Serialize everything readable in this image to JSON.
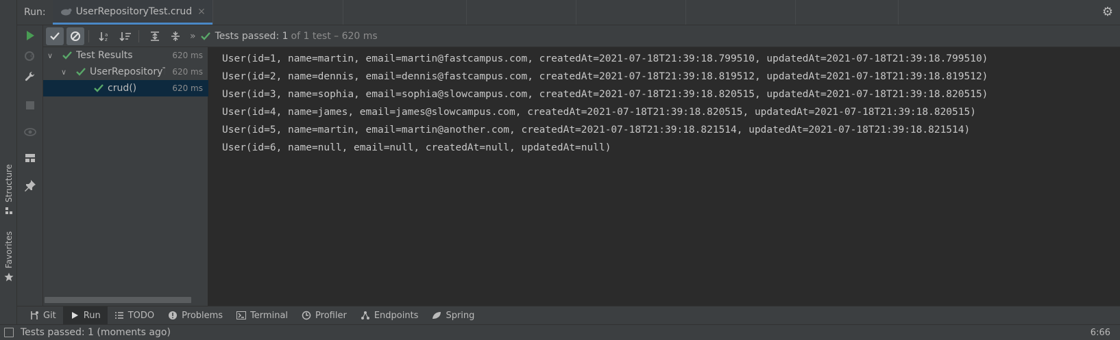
{
  "titlebar": {
    "run_label": "Run:",
    "tab_title": "UserRepositoryTest.crud",
    "close_glyph": "×",
    "settings_glyph": "⚙"
  },
  "toolbar": {
    "status_strong": "Tests passed: 1",
    "status_muted": "of 1 test – 620 ms",
    "overflow_glyph": "»"
  },
  "tree": {
    "rows": [
      {
        "label": "Test Results",
        "duration": "620 ms",
        "arrow": "∨"
      },
      {
        "label": "UserRepositoryTest",
        "duration": "620 ms",
        "arrow": "∨"
      },
      {
        "label": "crud()",
        "duration": "620 ms"
      }
    ]
  },
  "console": {
    "lines": [
      "User(id=1, name=martin, email=martin@fastcampus.com, createdAt=2021-07-18T21:39:18.799510, updatedAt=2021-07-18T21:39:18.799510)",
      "User(id=2, name=dennis, email=dennis@fastcampus.com, createdAt=2021-07-18T21:39:18.819512, updatedAt=2021-07-18T21:39:18.819512)",
      "User(id=3, name=sophia, email=sophia@slowcampus.com, createdAt=2021-07-18T21:39:18.820515, updatedAt=2021-07-18T21:39:18.820515)",
      "User(id=4, name=james, email=james@slowcampus.com, createdAt=2021-07-18T21:39:18.820515, updatedAt=2021-07-18T21:39:18.820515)",
      "User(id=5, name=martin, email=martin@another.com, createdAt=2021-07-18T21:39:18.821514, updatedAt=2021-07-18T21:39:18.821514)",
      "User(id=6, name=null, email=null, createdAt=null, updatedAt=null)"
    ]
  },
  "left_strip": {
    "structure_label": "Structure",
    "favorites_label": "Favorites"
  },
  "bottom_tabs": [
    {
      "label": "Git",
      "icon": "git-icon"
    },
    {
      "label": "Run",
      "icon": "run-icon"
    },
    {
      "label": "TODO",
      "icon": "todo-icon"
    },
    {
      "label": "Problems",
      "icon": "problems-icon"
    },
    {
      "label": "Terminal",
      "icon": "terminal-icon"
    },
    {
      "label": "Profiler",
      "icon": "profiler-icon"
    },
    {
      "label": "Endpoints",
      "icon": "endpoints-icon"
    },
    {
      "label": "Spring",
      "icon": "spring-icon"
    }
  ],
  "statusbar": {
    "message": "Tests passed: 1 (moments ago)",
    "position": "6:66"
  },
  "colors": {
    "accent": "#4a88c7",
    "pass_green": "#59a869",
    "run_green": "#499c54"
  }
}
